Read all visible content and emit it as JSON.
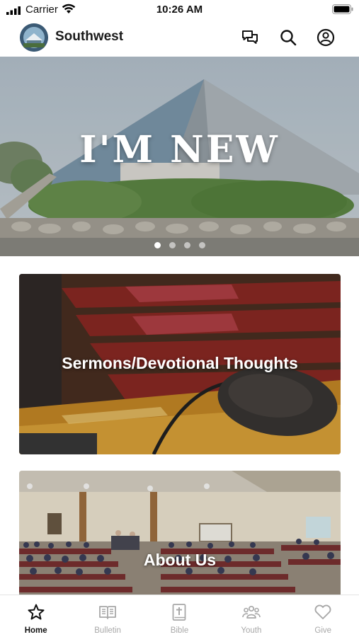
{
  "status_bar": {
    "carrier": "Carrier",
    "time": "10:26 AM"
  },
  "header": {
    "title": "Southwest",
    "icons": [
      "chat-icon",
      "search-icon",
      "account-icon"
    ]
  },
  "hero": {
    "title": "I'M NEW",
    "slide_count": 4,
    "active_slide": 1
  },
  "cards": [
    {
      "label": "Sermons/Devotional Thoughts"
    },
    {
      "label": "About Us"
    }
  ],
  "tabs": [
    {
      "label": "Home",
      "icon": "star-icon",
      "active": true
    },
    {
      "label": "Bulletin",
      "icon": "book-icon",
      "active": false
    },
    {
      "label": "Bible",
      "icon": "bible-icon",
      "active": false
    },
    {
      "label": "Youth",
      "icon": "people-icon",
      "active": false
    },
    {
      "label": "Give",
      "icon": "heart-icon",
      "active": false
    }
  ],
  "colors": {
    "active_tab": "#111111",
    "inactive_tab": "#a8a8a8",
    "logo_bg": "#3b5a75"
  }
}
